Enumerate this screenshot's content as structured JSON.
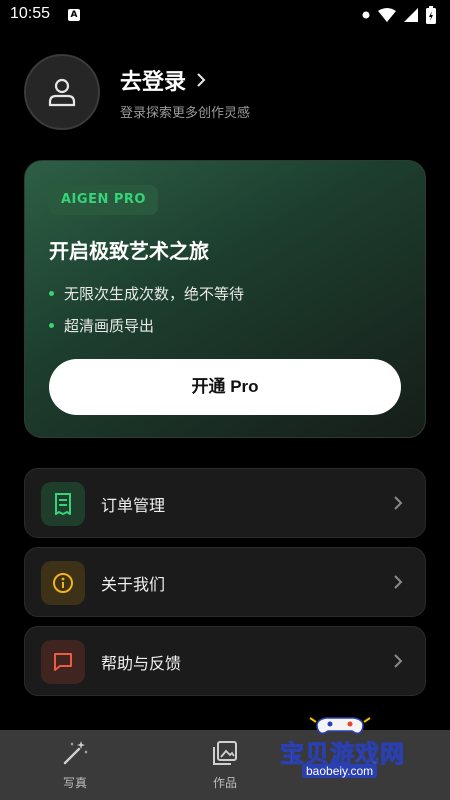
{
  "status_bar": {
    "time": "10:55",
    "indicator": "A"
  },
  "profile": {
    "title": "去登录",
    "subtitle": "登录探索更多创作灵感",
    "avatar_icon": "user-icon"
  },
  "pro_card": {
    "badge": "AIGEN PRO",
    "title": "开启极致艺术之旅",
    "features": [
      "无限次生成次数，绝不等待",
      "超清画质导出"
    ],
    "button_label": "开通 Pro",
    "accent": "#36d37a"
  },
  "menu": {
    "items": [
      {
        "label": "订单管理",
        "icon": "receipt-icon",
        "color": "#36d37a"
      },
      {
        "label": "关于我们",
        "icon": "info-icon",
        "color": "#f2b21b"
      },
      {
        "label": "帮助与反馈",
        "icon": "chat-icon",
        "color": "#ee5b45"
      }
    ]
  },
  "bottom_nav": {
    "items": [
      {
        "label": "写真",
        "icon": "magic-wand-icon"
      },
      {
        "label": "作品",
        "icon": "gallery-icon"
      }
    ]
  },
  "watermark": {
    "text": "宝贝游戏网",
    "url": "baobeiy.com"
  }
}
